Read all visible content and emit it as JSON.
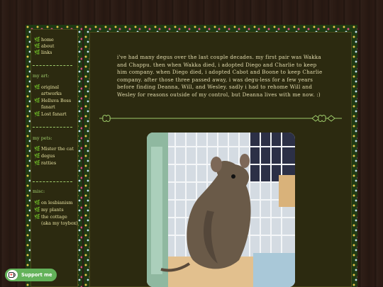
{
  "nav": {
    "group1": [
      {
        "label": "home"
      },
      {
        "label": "about"
      },
      {
        "label": "links"
      }
    ],
    "art_label": "my art:",
    "group2": [
      {
        "label": "original artworks"
      },
      {
        "label": "Helluva Boss fanart"
      },
      {
        "label": "Lost fanart"
      }
    ],
    "pets_label": "my pets:",
    "group3": [
      {
        "label": "Mister the cat"
      },
      {
        "label": "degus"
      },
      {
        "label": "ratties"
      }
    ],
    "misc_label": "misc:",
    "group4": [
      {
        "label": "on lesbianism"
      },
      {
        "label": "my plants"
      },
      {
        "label": "the cottage (aka my toybox)"
      }
    ]
  },
  "main": {
    "intro": "i've had many degus over the last couple decades. my first pair was Wakka and Chappu. then when Wakka died, i adopted Diego and Charlie to keep him company. when Diego died, i adopted Cabot and Boone to keep Charlie company. after those three passed away, i was degu-less for a few years before finding Deanna, Will, and Wesley. sadly i had to rehome Will and Wesley for reasons outside of my control, but Deanna lives with me now. :)"
  },
  "support": {
    "label": "Support me",
    "icon": "kofi-cup-icon"
  },
  "colors": {
    "sidebar_text": "#e6e0a0",
    "accent_green": "#9ecb6a",
    "panel_bg": "#2c2a10",
    "support_bg": "#63b25a"
  }
}
